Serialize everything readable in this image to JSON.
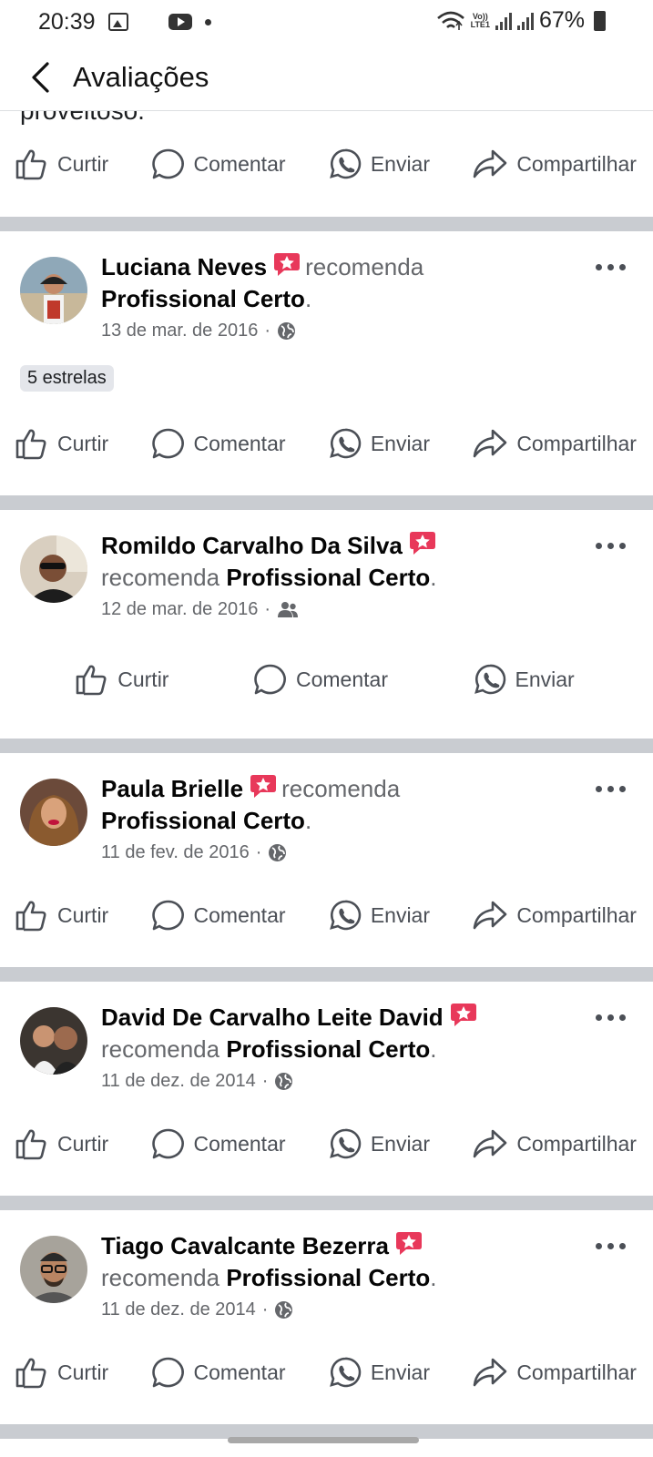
{
  "status_bar": {
    "time": "20:39",
    "battery": "67%",
    "icons": [
      "image-icon",
      "youtube-icon",
      "dot-icon",
      "wifi-icon",
      "volte-icon",
      "signal-icon",
      "signal-icon",
      "battery-icon"
    ],
    "lte_label_top": "Vo))",
    "lte_label_bottom": "LTE1"
  },
  "header": {
    "title": "Avaliações",
    "back_icon": "back-arrow-icon"
  },
  "previous_post_tail": "proveitoso.",
  "actions": {
    "like": "Curtir",
    "comment": "Comentar",
    "send": "Enviar",
    "share": "Compartilhar"
  },
  "recommends_text": "recomenda",
  "page_name": "Profissional Certo",
  "posts": [
    {
      "author": "Luciana Neves",
      "date": "13 de mar. de 2016",
      "audience_icon": "globe-icon",
      "rating": "5 estrelas"
    },
    {
      "author": "Romildo Carvalho Da Silva",
      "date": "12 de mar. de 2016",
      "audience_icon": "friends-icon"
    },
    {
      "author": "Paula Brielle",
      "date": "11 de fev. de 2016",
      "audience_icon": "globe-icon"
    },
    {
      "author": "David De Carvalho Leite David",
      "date": "11 de dez. de 2014",
      "audience_icon": "globe-icon"
    },
    {
      "author": "Tiago Cavalcante Bezerra",
      "date": "11 de dez. de 2014",
      "audience_icon": "globe-icon"
    }
  ],
  "colors": {
    "divider": "#c9ccd1",
    "secondary_text": "#65676b",
    "badge": "#e8385a"
  }
}
